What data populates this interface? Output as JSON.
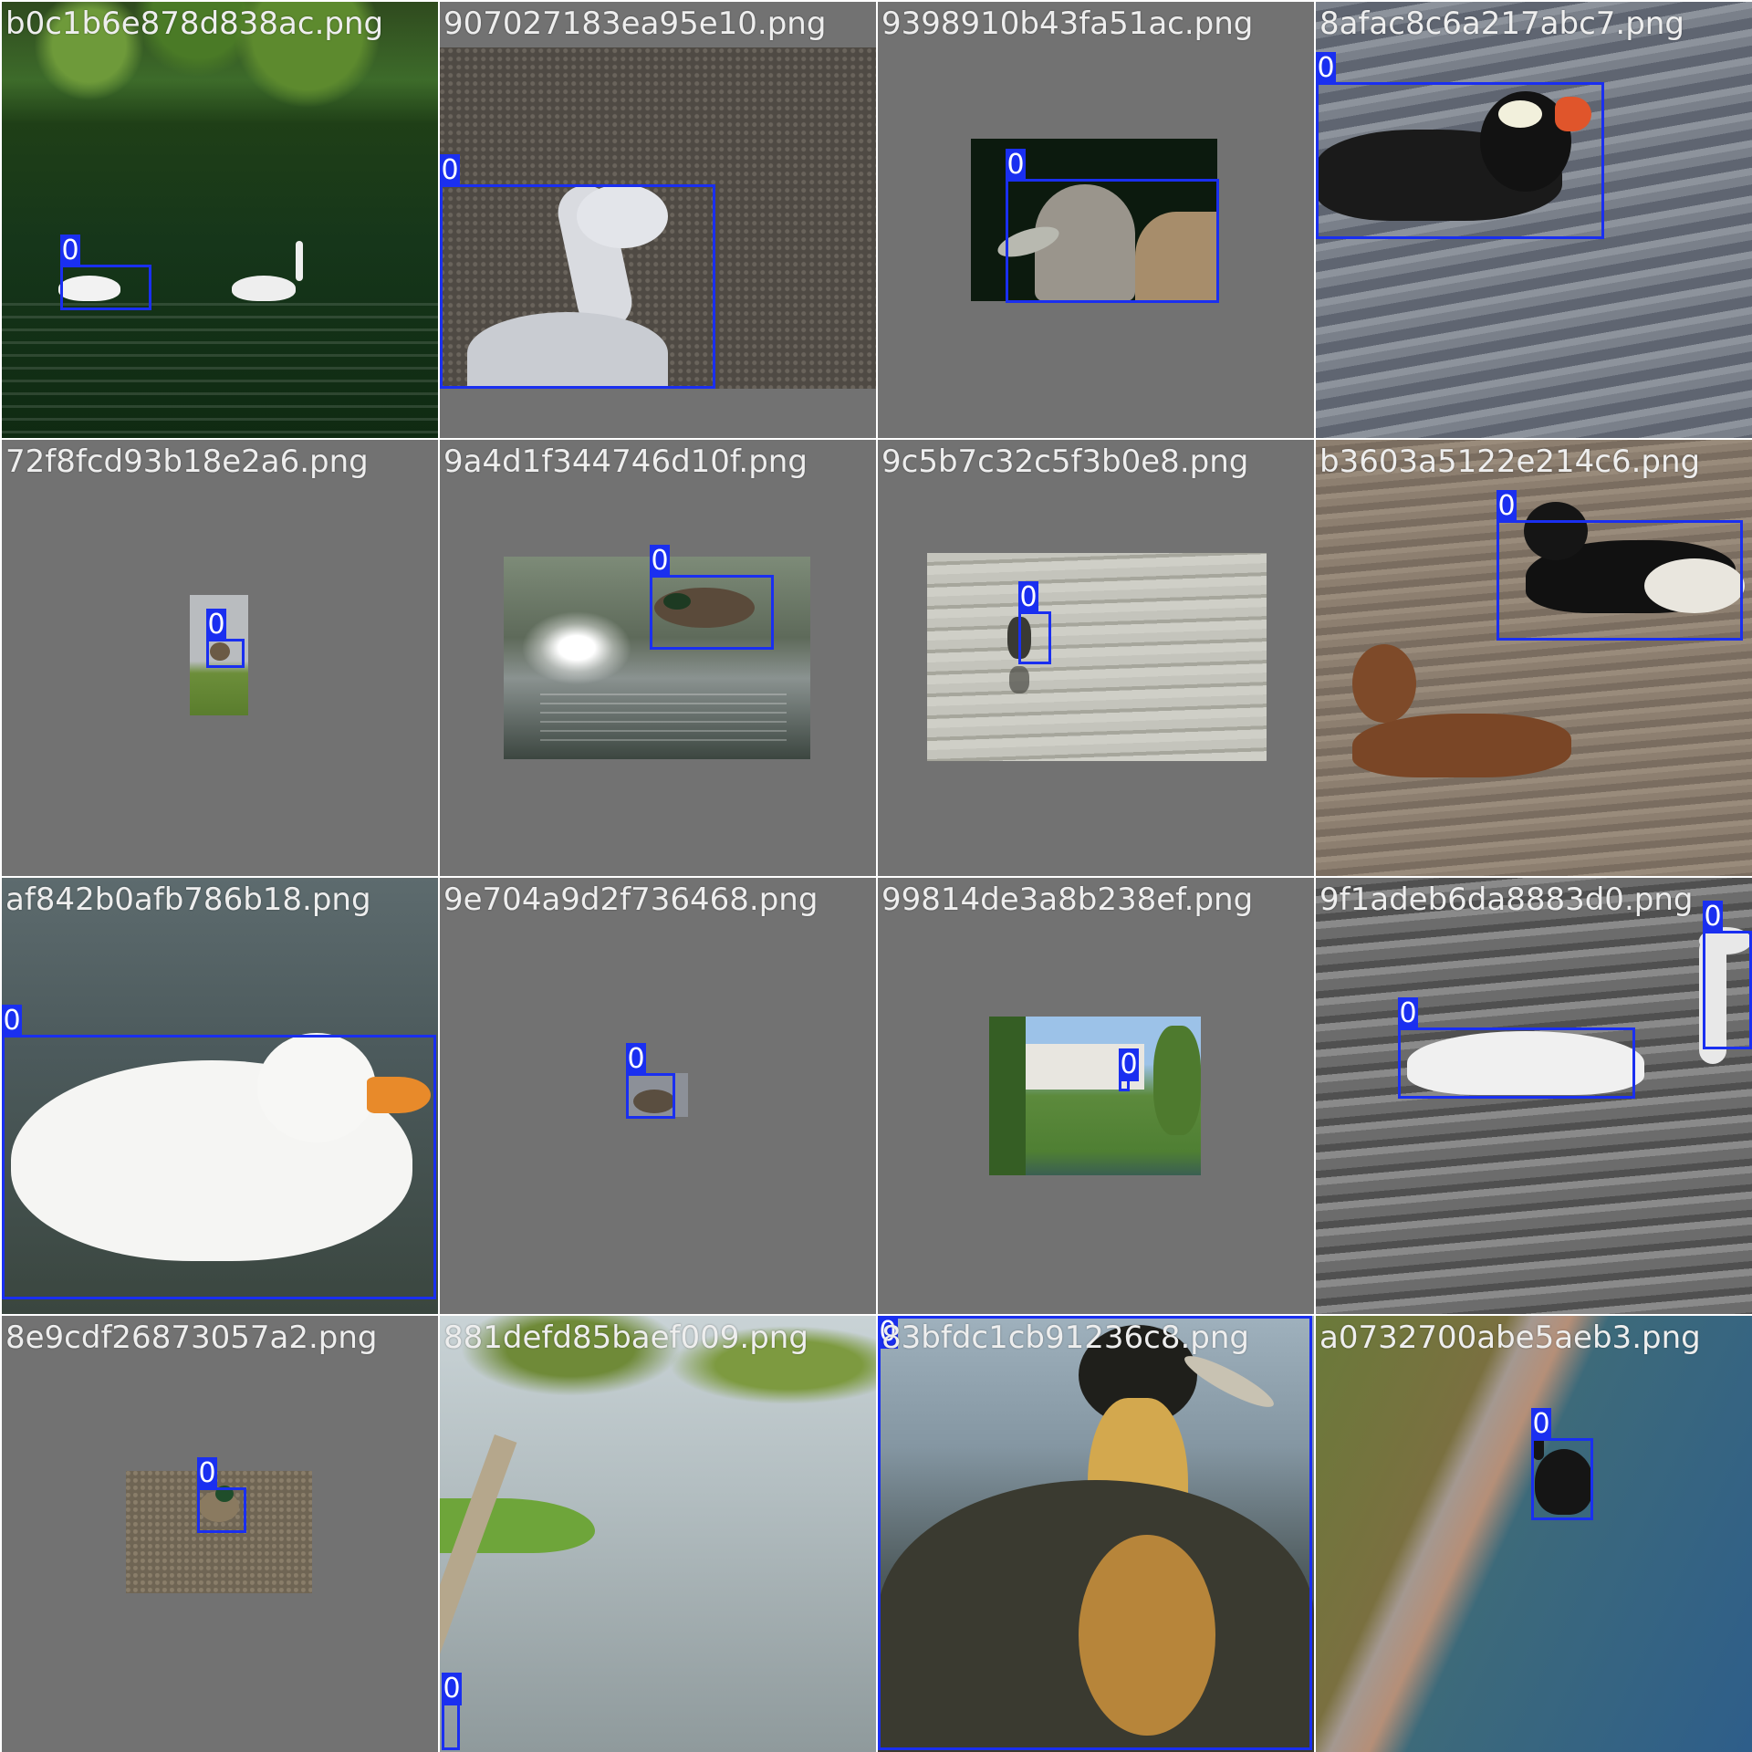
{
  "colors": {
    "box": "#1a2ff0",
    "label_text": "#ffffff",
    "filename_text": "#eeeeee",
    "pad": "#727272"
  },
  "tiles": [
    {
      "filename": "b0c1b6e878d838ac.png",
      "labels": [
        "0"
      ]
    },
    {
      "filename": "907027183ea95e10.png",
      "labels": [
        "0"
      ]
    },
    {
      "filename": "9398910b43fa51ac.png",
      "labels": [
        "0"
      ]
    },
    {
      "filename": "8afac8c6a217abc7.png",
      "labels": [
        "0"
      ]
    },
    {
      "filename": "72f8fcd93b18e2a6.png",
      "labels": [
        "0"
      ]
    },
    {
      "filename": "9a4d1f344746d10f.png",
      "labels": [
        "0"
      ]
    },
    {
      "filename": "9c5b7c32c5f3b0e8.png",
      "labels": [
        "0"
      ]
    },
    {
      "filename": "b3603a5122e214c6.png",
      "labels": [
        "0"
      ]
    },
    {
      "filename": "af842b0afb786b18.png",
      "labels": [
        "0"
      ]
    },
    {
      "filename": "9e704a9d2f736468.png",
      "labels": [
        "0"
      ]
    },
    {
      "filename": "99814de3a8b238ef.png",
      "labels": [
        "0"
      ]
    },
    {
      "filename": "9f1adeb6da8883d0.png",
      "labels": [
        "0",
        "0"
      ]
    },
    {
      "filename": "8e9cdf26873057a2.png",
      "labels": [
        "0"
      ]
    },
    {
      "filename": "881defd85baef009.png",
      "labels": [
        "0"
      ]
    },
    {
      "filename": "83bfdc1cb91236c8.png",
      "labels": [
        "0"
      ]
    },
    {
      "filename": "a0732700abe5aeb3.png",
      "labels": [
        "0"
      ]
    }
  ]
}
